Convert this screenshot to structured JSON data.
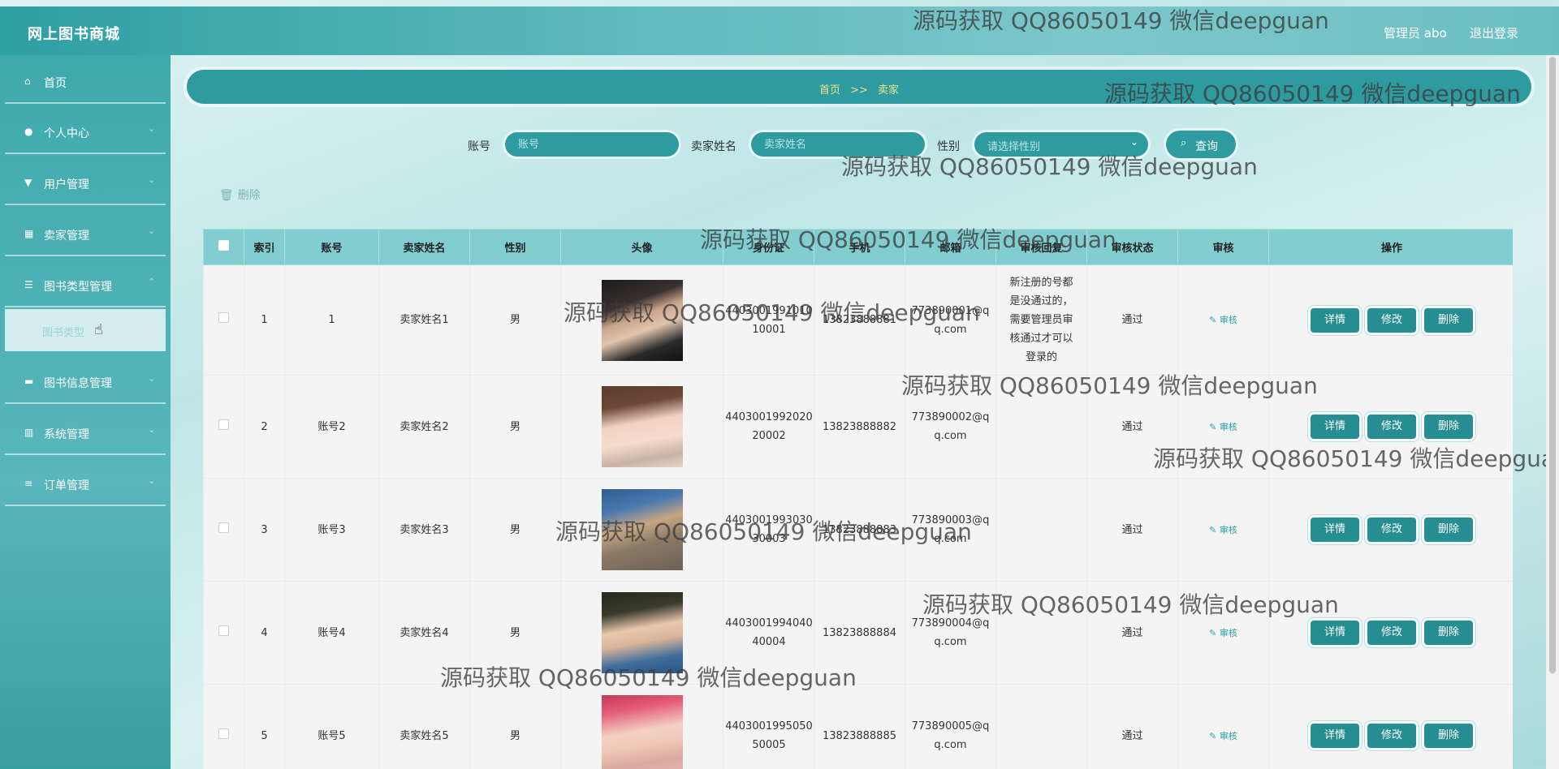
{
  "header": {
    "brand": "网上图书商城",
    "admin_label": "管理员 abo",
    "logout_label": "退出登录"
  },
  "sidebar": {
    "items": [
      {
        "label": "首页"
      },
      {
        "label": "个人中心"
      },
      {
        "label": "用户管理"
      },
      {
        "label": "卖家管理"
      },
      {
        "label": "图书类型管理"
      },
      {
        "label": "图书信息管理"
      },
      {
        "label": "系统管理"
      },
      {
        "label": "订单管理"
      }
    ],
    "active_sub": "图书类型"
  },
  "breadcrumb": {
    "home": "首页",
    "sep": ">>",
    "current": "卖家"
  },
  "search": {
    "account_label": "账号",
    "account_placeholder": "账号",
    "name_label": "卖家姓名",
    "name_placeholder": "卖家姓名",
    "gender_label": "性别",
    "gender_placeholder": "请选择性别",
    "query_label": "查询"
  },
  "toolbar": {
    "delete_label": "删除"
  },
  "table": {
    "headers": [
      "索引",
      "账号",
      "卖家姓名",
      "性别",
      "头像",
      "身份证",
      "手机",
      "邮箱",
      "审核回复",
      "审核状态",
      "审核",
      "操作"
    ],
    "audit_link": "审核",
    "btn_detail": "详情",
    "btn_edit": "修改",
    "btn_delete": "删除",
    "rows": [
      {
        "index": "1",
        "account": "1",
        "name": "卖家姓名1",
        "gender": "男",
        "id_card": "440300199101010001",
        "phone": "13823888881",
        "email": "773890001@qq.com",
        "reply": "新注册的号都是没通过的，需要管理员审核通过才可以登录的",
        "status": "通过"
      },
      {
        "index": "2",
        "account": "账号2",
        "name": "卖家姓名2",
        "gender": "男",
        "id_card": "440300199202020002",
        "phone": "13823888882",
        "email": "773890002@qq.com",
        "reply": "",
        "status": "通过"
      },
      {
        "index": "3",
        "account": "账号3",
        "name": "卖家姓名3",
        "gender": "男",
        "id_card": "440300199303030003",
        "phone": "13823888883",
        "email": "773890003@qq.com",
        "reply": "",
        "status": "通过"
      },
      {
        "index": "4",
        "account": "账号4",
        "name": "卖家姓名4",
        "gender": "男",
        "id_card": "440300199404040004",
        "phone": "13823888884",
        "email": "773890004@qq.com",
        "reply": "",
        "status": "通过"
      },
      {
        "index": "5",
        "account": "账号5",
        "name": "卖家姓名5",
        "gender": "男",
        "id_card": "440300199505050005",
        "phone": "13823888885",
        "email": "773890005@qq.com",
        "reply": "",
        "status": "通过"
      }
    ]
  },
  "watermark_text": "源码获取 QQ86050149 微信deepguan"
}
